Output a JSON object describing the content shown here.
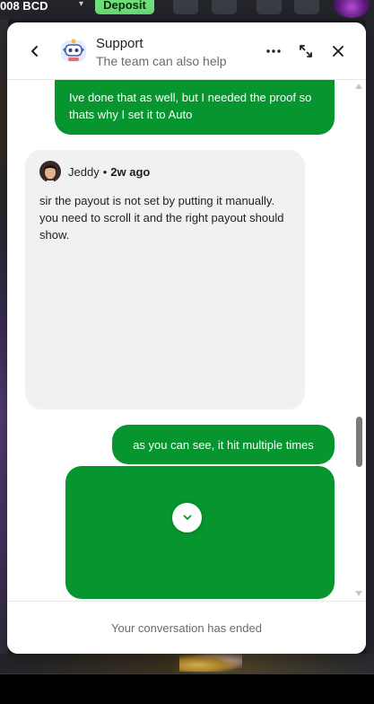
{
  "background": {
    "balance": "008 BCD",
    "deposit_label": "Deposit"
  },
  "chat": {
    "title": "Support",
    "subtitle": "The team can also help",
    "header_icons": {
      "back": "chevron-left-icon",
      "more": "more-horizontal-icon",
      "expand": "expand-icon",
      "close": "close-icon"
    },
    "messages": [
      {
        "direction": "outgoing",
        "text": "Ive done that as well, but I needed the proof so thats why I set it to Auto"
      },
      {
        "direction": "incoming",
        "author": "Jeddy",
        "separator": "•",
        "time": "2w ago",
        "text": "sir the payout is not set by putting it manually. you need to scroll it and the right payout should show."
      },
      {
        "direction": "outgoing",
        "text": "as you can see, it hit multiple times"
      },
      {
        "direction": "outgoing",
        "type": "image",
        "text": ""
      }
    ],
    "footer_status": "Your conversation has ended",
    "colors": {
      "outgoing_bubble": "#06952e",
      "incoming_bubble": "#f1f1f1"
    }
  }
}
